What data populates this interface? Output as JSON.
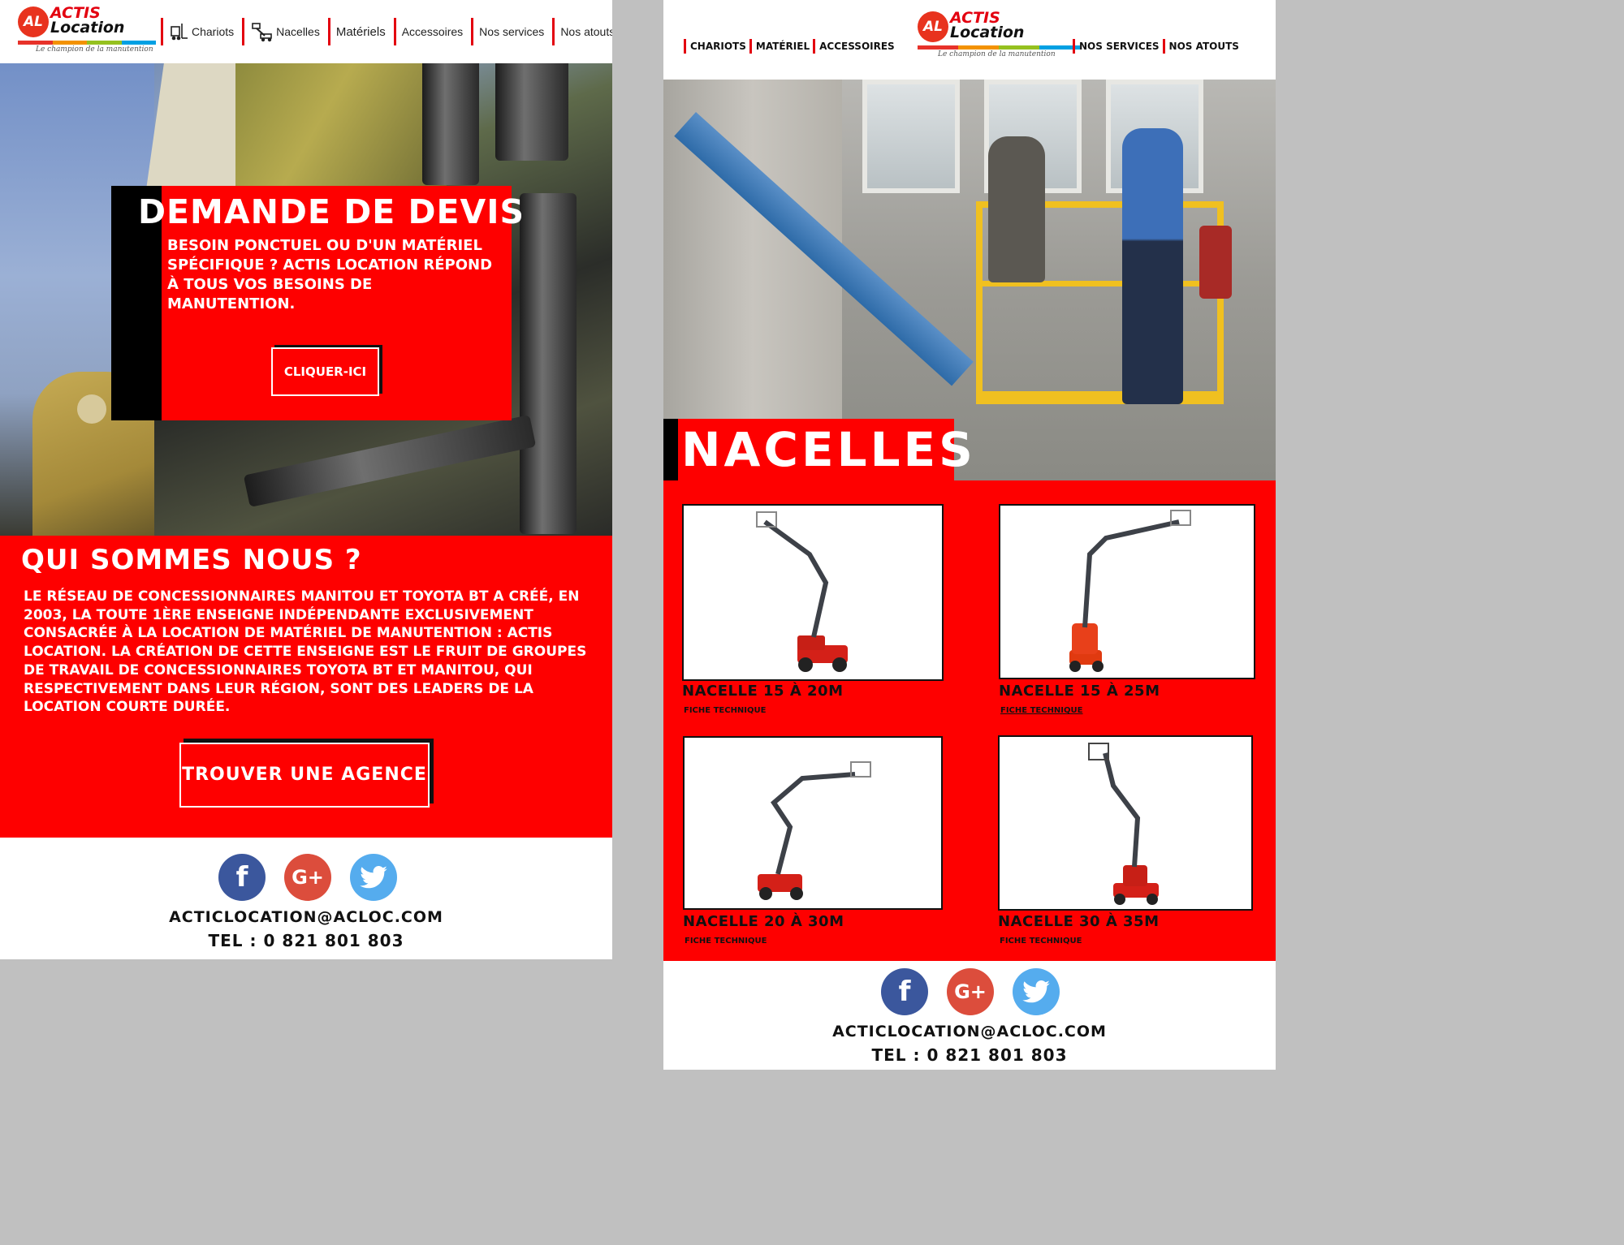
{
  "left": {
    "logo": {
      "badge": "AL",
      "line1": "ACTIS",
      "line2": "Location",
      "tagline": "Le champion de la manutention"
    },
    "nav": [
      "Chariots",
      "Nacelles",
      "Matériels",
      "Accessoires",
      "Nos services",
      "Nos atouts"
    ],
    "devis": {
      "title": "DEMANDE DE DEVIS",
      "text": "Besoin ponctuel ou d'un matériel spécifique ? Actis Location répond à tous vos besoins de manutention.",
      "button": "CLIQUER-ICI"
    },
    "qui": {
      "title": "QUI SOMMES NOUS ?",
      "text": "Le réseau de concessionnaires Manitou et Toyota BT a créé, en 2003, la toute 1ère enseigne indépendante exclusivement consacrée à la location de matériel de manutention : Actis Location. La création de cette enseigne est le fruit de groupes de travail de concessionnaires Toyota BT et Manitou, qui respectivement dans leur région, sont des leaders de la location courte durée.",
      "button": "TROUVER UNE AGENCE"
    },
    "footer": {
      "email": "ACTICLOCATION@ACLOC.COM",
      "tel": "TEL : 0 821 801 803"
    }
  },
  "right": {
    "logo": {
      "badge": "AL",
      "line1": "ACTIS",
      "line2": "Location",
      "tagline": "Le champion de la manutention"
    },
    "nav_left": [
      "CHARIOTS",
      "MATÉRIEL",
      "ACCESSOIRES"
    ],
    "nav_right": [
      "NOS SERVICES",
      "NOS ATOUTS"
    ],
    "hero_title": "NACELLES",
    "products": [
      {
        "name": "NACELLE 15 À 20M",
        "fiche": "FICHE TECHNIQUE"
      },
      {
        "name": "NACELLE 15 À 25M",
        "fiche": "FICHE TECHNIQUE"
      },
      {
        "name": "NACELLE 20 À 30M",
        "fiche": "FICHE TECHNIQUE"
      },
      {
        "name": "NACELLE 30 À 35M",
        "fiche": "FICHE TECHNIQUE"
      }
    ],
    "footer": {
      "email": "ACTICLOCATION@ACLOC.COM",
      "tel": "TEL : 0 821 801 803"
    }
  },
  "colors": {
    "brand_red": "#fe0000",
    "accent_black": "#000000",
    "facebook": "#3b579d",
    "googleplus": "#dc4d3c",
    "twitter": "#55acee"
  },
  "social_icons": [
    "facebook-icon",
    "google-plus-icon",
    "twitter-icon"
  ]
}
